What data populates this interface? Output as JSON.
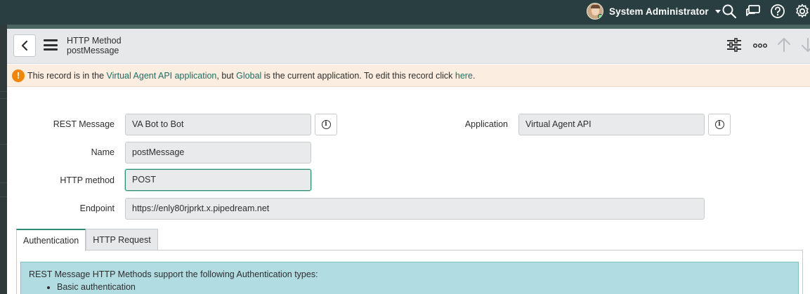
{
  "banner": {
    "user_name": "System Administrator",
    "icons": [
      "search-icon",
      "chat-icon",
      "help-icon",
      "gear-icon"
    ]
  },
  "header": {
    "table_label": "HTTP Method",
    "record_name": "postMessage",
    "icons": [
      "back-icon",
      "menu-icon",
      "personalize-icon",
      "more-icon",
      "up-arrow-icon",
      "down-arrow-icon"
    ]
  },
  "notice": {
    "prefix": "This record is in the ",
    "app_link": "Virtual Agent API application",
    "middle": ", but ",
    "scope_link": "Global",
    "suffix": " is the current application. To edit this record click ",
    "here_link": "here",
    "end": "."
  },
  "form": {
    "rest_message_label": "REST Message",
    "rest_message_value": "VA Bot to Bot",
    "application_label": "Application",
    "application_value": "Virtual Agent API",
    "name_label": "Name",
    "name_value": "postMessage",
    "http_method_label": "HTTP method",
    "http_method_value": "POST",
    "endpoint_label": "Endpoint",
    "endpoint_value": "https://enly80rjprkt.x.pipedream.net"
  },
  "tabs": [
    {
      "label": "Authentication",
      "active": true
    },
    {
      "label": "HTTP Request",
      "active": false
    }
  ],
  "auth_info": {
    "text": "REST Message HTTP Methods support the following Authentication types:",
    "items": [
      "Basic authentication"
    ]
  },
  "colors": {
    "banner_bg": "#293e40",
    "accent": "#2d8a74",
    "warning": "#f0850c",
    "info_bg": "#b1dce2"
  }
}
